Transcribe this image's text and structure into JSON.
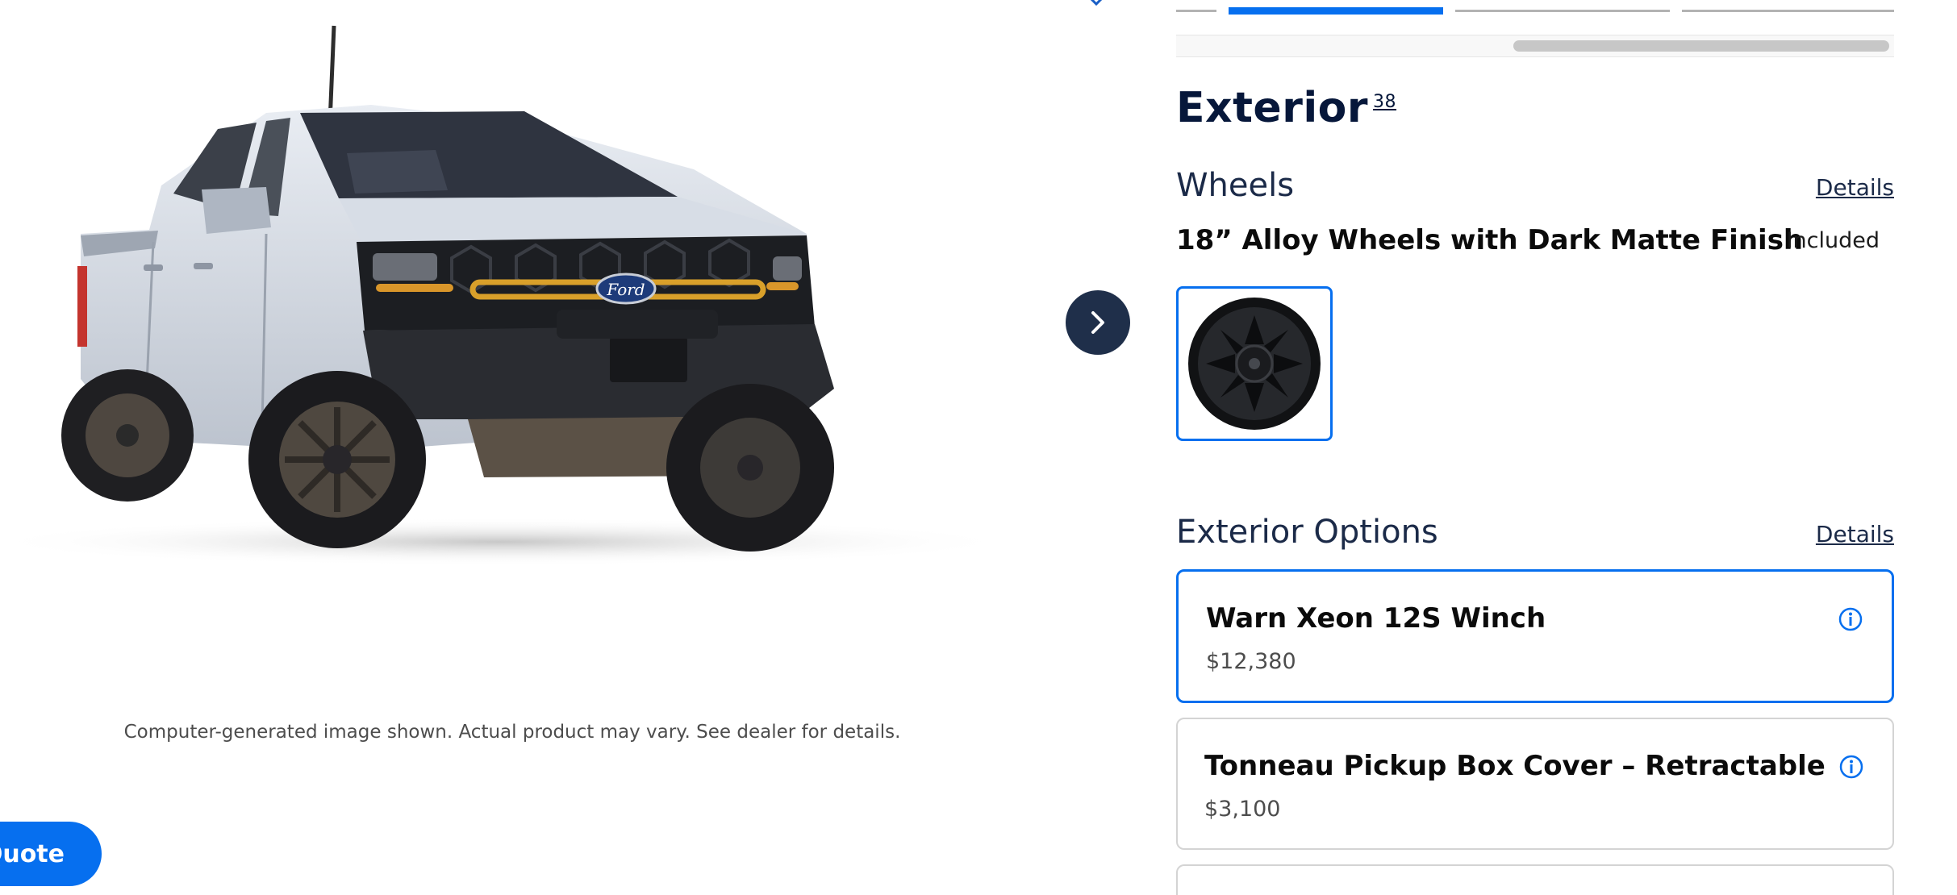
{
  "vehicle": {
    "disclaimer": "Computer-generated image shown. Actual product may vary. See dealer for details.",
    "grille_badge": "Ford"
  },
  "actions": {
    "next_icon": "chevron-right-icon",
    "quote_label": "Quote"
  },
  "exterior": {
    "title": "Exterior",
    "count": "38",
    "wheels": {
      "heading": "Wheels",
      "details_label": "Details",
      "selected_name": "18” Alloy Wheels with Dark Matte Finish",
      "status": "Included"
    },
    "options": {
      "heading": "Exterior Options",
      "details_label": "Details",
      "items": [
        {
          "name": "Warn Xeon 12S Winch",
          "price": "$12,380",
          "selected": true
        },
        {
          "name": "Tonneau Pickup Box Cover – Retractable",
          "price": "$3,100",
          "selected": false
        }
      ]
    }
  },
  "colors": {
    "accent": "#066fef",
    "nav_button": "#1f2f4a",
    "heading": "#06173a"
  }
}
